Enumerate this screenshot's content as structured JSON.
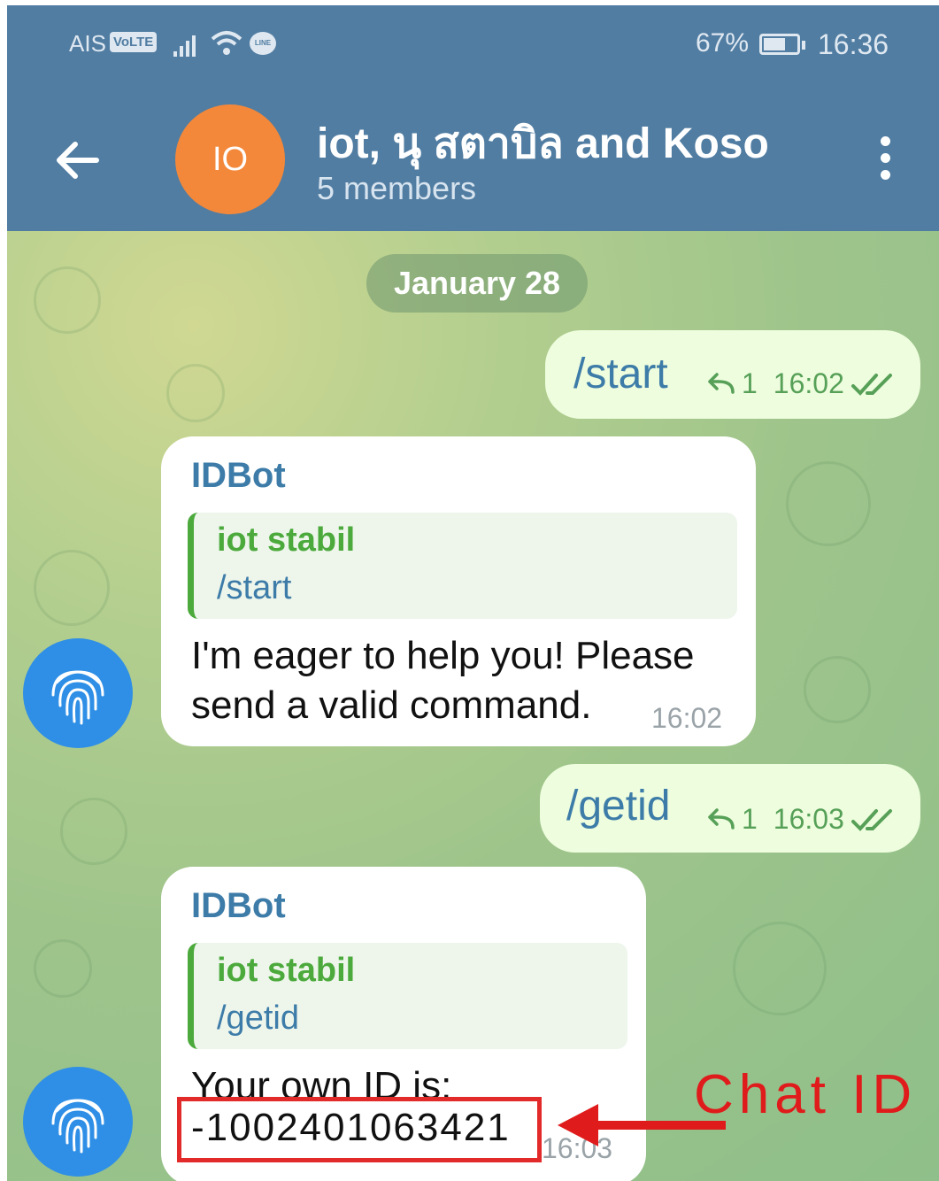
{
  "status_bar": {
    "carrier": "AIS",
    "volte": "VoLTE",
    "line_badge": "LINE",
    "battery_percent": "67%",
    "battery_level": 0.67,
    "time": "16:36"
  },
  "app_bar": {
    "avatar_initials": "IO",
    "avatar_color": "#f4883a",
    "title": "iot, นุ สตาบิล and Koso",
    "subtitle": "5 members",
    "back_icon": "arrow-left-icon",
    "menu_icon": "more-vertical-icon"
  },
  "chat": {
    "date_separator": "January 28",
    "messages": [
      {
        "type": "outgoing",
        "text": "/start",
        "replies": "1",
        "time": "16:02",
        "status": "read"
      },
      {
        "type": "incoming",
        "sender": "IDBot",
        "quote_name": "iot stabil",
        "quote_text": "/start",
        "text_line1": "I'm eager to help you! Please",
        "text_line2": "send a valid command.",
        "time": "16:02"
      },
      {
        "type": "outgoing",
        "text": "/getid",
        "replies": "1",
        "time": "16:03",
        "status": "read"
      },
      {
        "type": "incoming",
        "sender": "IDBot",
        "quote_name": "iot stabil",
        "quote_text": "/getid",
        "text_line1": "Your own ID is:",
        "id_value": "-1002401063421",
        "time": "16:03"
      }
    ]
  },
  "annotation": {
    "label": "Chat ID",
    "color": "#e01b1b"
  }
}
